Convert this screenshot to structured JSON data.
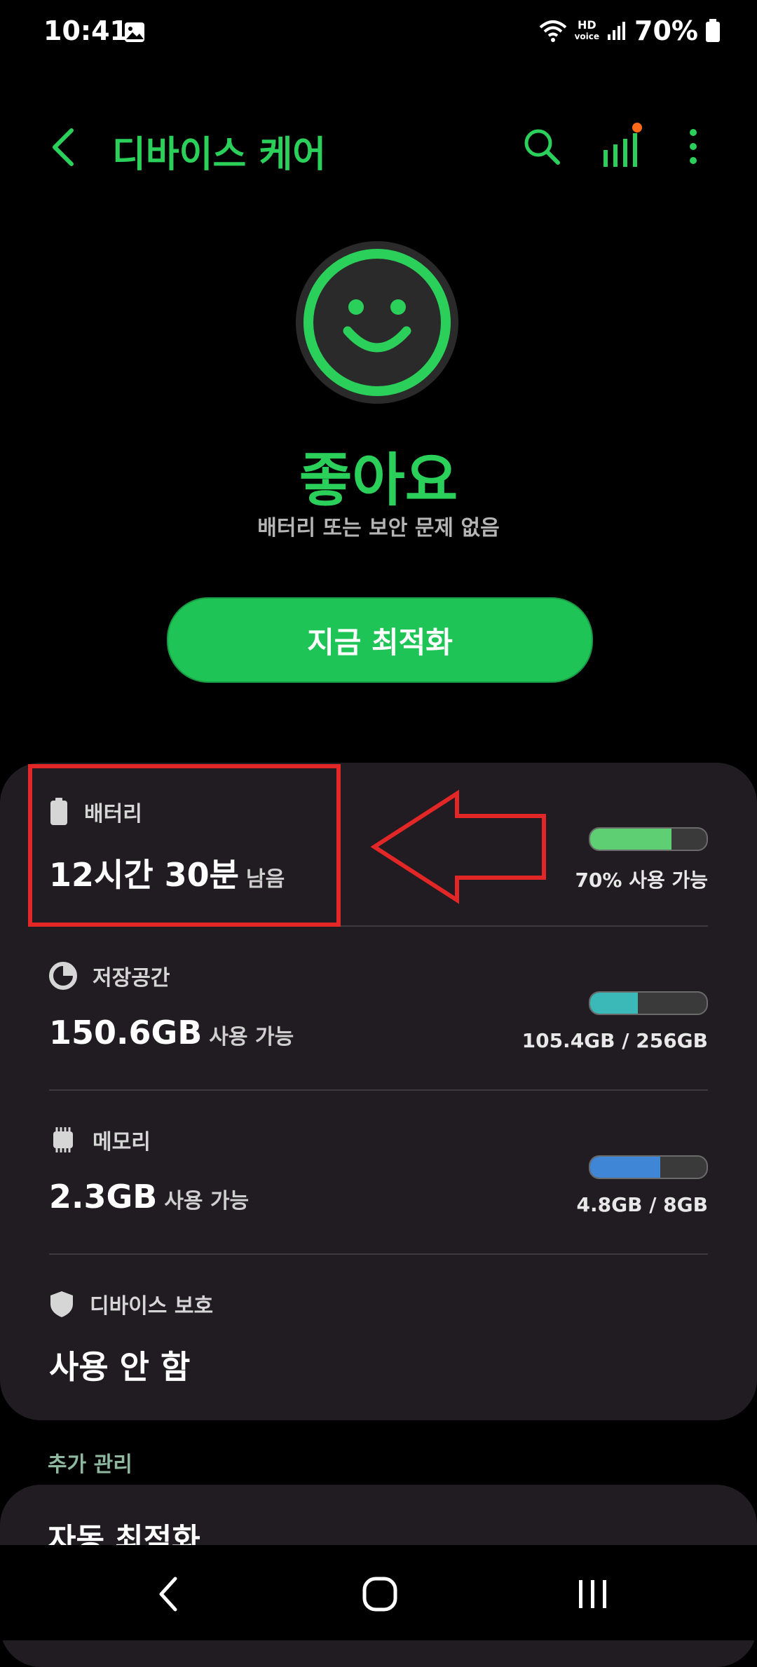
{
  "status_bar": {
    "time": "10:41",
    "hd_top": "HD",
    "hd_bottom": "voice",
    "battery_percent": "70%"
  },
  "header": {
    "title": "디바이스 케어"
  },
  "hero": {
    "status_title": "좋아요",
    "status_subtitle": "배터리 또는 보안 문제 없음",
    "optimize_button": "지금 최적화"
  },
  "card": {
    "rows": [
      {
        "label": "배터리",
        "value": "12시간 30분",
        "suffix": "남음",
        "bar_fraction": 0.7,
        "bar_color": "#5fcf73",
        "caption": "70% 사용 가능",
        "icon": "battery-icon"
      },
      {
        "label": "저장공간",
        "value": "150.6GB",
        "suffix": "사용 가능",
        "bar_fraction": 0.41,
        "bar_color": "#3bb8b8",
        "caption": "105.4GB / 256GB",
        "icon": "storage-pie-icon"
      },
      {
        "label": "메모리",
        "value": "2.3GB",
        "suffix": "사용 가능",
        "bar_fraction": 0.6,
        "bar_color": "#3f86d6",
        "caption": "4.8GB / 8GB",
        "icon": "memory-chip-icon"
      },
      {
        "label": "디바이스 보호",
        "value": "사용 안 함",
        "icon": "shield-icon"
      }
    ]
  },
  "extra": {
    "header": "추가 관리",
    "first_item": "자동 최적화"
  },
  "colors": {
    "accent": "#2bd05a",
    "card_bg": "#211c21",
    "annotation_red": "#e32626"
  }
}
